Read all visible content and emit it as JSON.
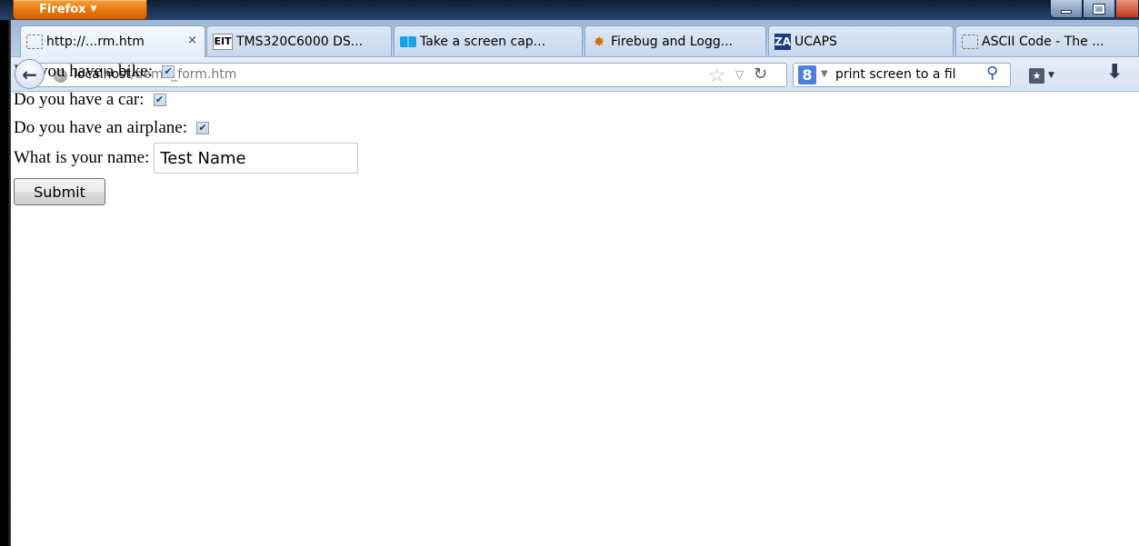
{
  "window": {
    "menu_button_label": "Firefox",
    "menu_button_caret": "▼"
  },
  "tabs": [
    {
      "label": "http://...rm.htm",
      "icon": "blank-page-icon",
      "active": true,
      "close": "×"
    },
    {
      "label": "TMS320C6000 DS...",
      "icon": "eit-icon",
      "icon_text": "EIT"
    },
    {
      "label": "Take a screen cap...",
      "icon": "windows-icon"
    },
    {
      "label": "Firebug and Logg...",
      "icon": "firebug-icon"
    },
    {
      "label": "UCAPS",
      "icon": "ucaps-icon",
      "icon_text": "ZA"
    },
    {
      "label": "ASCII Code - The ...",
      "icon": "blank-page-icon"
    }
  ],
  "navbar": {
    "url_host": "localhost",
    "url_path": "/demo_form.htm",
    "search_engine_letter": "8",
    "search_text": "print screen to a fil"
  },
  "form": {
    "bike_label": "Do you have a bike:",
    "bike_checked": true,
    "car_label": "Do you have a car:",
    "car_checked": true,
    "airplane_label": "Do you have an airplane:",
    "airplane_checked": true,
    "name_label": "What is your name:",
    "name_value": "Test Name",
    "submit_label": "Submit"
  },
  "colors": {
    "firefox_button": "#e8760f",
    "title_bar": "#1c3557",
    "tab_strip": "#b9cfea",
    "checkbox_check": "#23417a"
  }
}
